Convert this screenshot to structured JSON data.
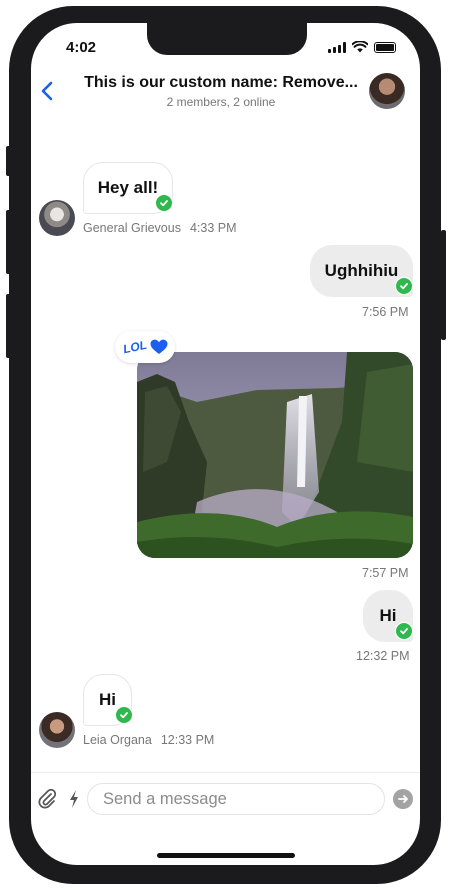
{
  "status_bar": {
    "time": "4:02"
  },
  "header": {
    "title": "This is our custom name: Remove...",
    "subtitle": "2 members, 2 online"
  },
  "messages": [
    {
      "text": "Hey all!",
      "author": "General Grievous",
      "time": "4:33 PM",
      "direction": "incoming",
      "status": "read"
    },
    {
      "text": "Ughhihiu",
      "time": "7:56 PM",
      "direction": "outgoing",
      "status": "read"
    },
    {
      "type": "image",
      "time": "7:57 PM",
      "direction": "outgoing",
      "reactions": [
        "lol",
        "heart"
      ]
    },
    {
      "text": "Hi",
      "time": "12:32 PM",
      "direction": "outgoing",
      "status": "read"
    },
    {
      "text": "Hi",
      "author": "Leia Organa",
      "time": "12:33 PM",
      "direction": "incoming",
      "status": "read"
    }
  ],
  "reaction_lol": "LOL",
  "composer": {
    "placeholder": "Send a message"
  },
  "colors": {
    "accent": "#1a5ff0",
    "read_check": "#2fb84e",
    "outgoing_bubble": "#ececec"
  },
  "icons": [
    "back-chevron-icon",
    "attachment-icon",
    "commands-bolt-icon",
    "send-icon",
    "heart-icon",
    "checkmark-icon"
  ]
}
